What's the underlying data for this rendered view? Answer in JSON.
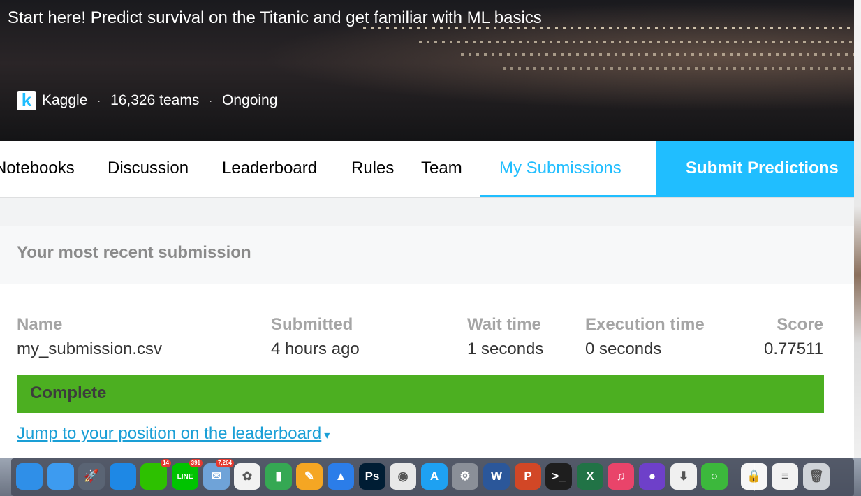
{
  "hero": {
    "title": "Start here! Predict survival on the Titanic and get familiar with ML basics",
    "org": "Kaggle",
    "logo_letter": "k",
    "teams": "16,326 teams",
    "status": "Ongoing",
    "separator": "·"
  },
  "tabs": {
    "items": [
      "Notebooks",
      "Discussion",
      "Leaderboard",
      "Rules",
      "Team",
      "My Submissions"
    ],
    "active": "My Submissions",
    "submit_label": "Submit Predictions"
  },
  "submission": {
    "heading": "Your most recent submission",
    "columns": {
      "name": {
        "label": "Name",
        "value": "my_submission.csv"
      },
      "submitted": {
        "label": "Submitted",
        "value": "4 hours ago"
      },
      "wait": {
        "label": "Wait time",
        "value": "1 seconds"
      },
      "execution": {
        "label": "Execution time",
        "value": "0 seconds"
      },
      "score": {
        "label": "Score",
        "value": "0.77511"
      }
    },
    "status": "Complete",
    "status_color": "#4caf21",
    "leaderboard_link": "Jump to your position on the leaderboard",
    "link_caret": "▾"
  },
  "colors": {
    "accent": "#20beff",
    "link": "#1a9fd6"
  },
  "dock": {
    "items": [
      {
        "name": "safari-icon",
        "glyph": "",
        "bg": "#2f8fe8"
      },
      {
        "name": "finder-icon",
        "glyph": "",
        "bg": "#3d9bf0"
      },
      {
        "name": "launchpad-icon",
        "glyph": "🚀",
        "bg": "#5a6474"
      },
      {
        "name": "safari-icon-2",
        "glyph": "",
        "bg": "#1e88e5"
      },
      {
        "name": "wechat-icon",
        "glyph": "",
        "bg": "#2dc100",
        "badge": "14"
      },
      {
        "name": "line-icon",
        "glyph": "LINE",
        "bg": "#00c300",
        "badge": "391"
      },
      {
        "name": "mail-icon",
        "glyph": "✉",
        "bg": "#6fa3d8",
        "badge": "7,264"
      },
      {
        "name": "photos-icon",
        "glyph": "✿",
        "bg": "#f2f2f2"
      },
      {
        "name": "numbers-icon",
        "glyph": "▮",
        "bg": "#35a853"
      },
      {
        "name": "pages-icon",
        "glyph": "✎",
        "bg": "#f5a623"
      },
      {
        "name": "keynote-icon",
        "glyph": "▲",
        "bg": "#2b7de9"
      },
      {
        "name": "photoshop-icon",
        "glyph": "Ps",
        "bg": "#001d34"
      },
      {
        "name": "chrome-icon",
        "glyph": "◉",
        "bg": "#e8e8e8"
      },
      {
        "name": "app-store-icon",
        "glyph": "A",
        "bg": "#1ea1f2"
      },
      {
        "name": "system-preferences-icon",
        "glyph": "⚙",
        "bg": "#8a8f98"
      },
      {
        "name": "word-icon",
        "glyph": "W",
        "bg": "#2b579a"
      },
      {
        "name": "powerpoint-icon",
        "glyph": "P",
        "bg": "#d24726"
      },
      {
        "name": "terminal-icon",
        "glyph": ">_",
        "bg": "#1e1e1e"
      },
      {
        "name": "excel-icon",
        "glyph": "X",
        "bg": "#217346"
      },
      {
        "name": "itunes-icon",
        "glyph": "♫",
        "bg": "#e9446a"
      },
      {
        "name": "github-icon",
        "glyph": "●",
        "bg": "#6e40c9"
      },
      {
        "name": "installer-icon",
        "glyph": "⬇",
        "bg": "#f0f0f0"
      },
      {
        "name": "refresh-ring-icon",
        "glyph": "○",
        "bg": "#3cb83c"
      },
      {
        "name": "pdf-document-icon",
        "glyph": "🔒",
        "bg": "#f7f7f7"
      },
      {
        "name": "document-stack-icon",
        "glyph": "≡",
        "bg": "#f2f2f2"
      },
      {
        "name": "trash-icon",
        "glyph": "🗑",
        "bg": "#cfd3d8"
      }
    ]
  }
}
